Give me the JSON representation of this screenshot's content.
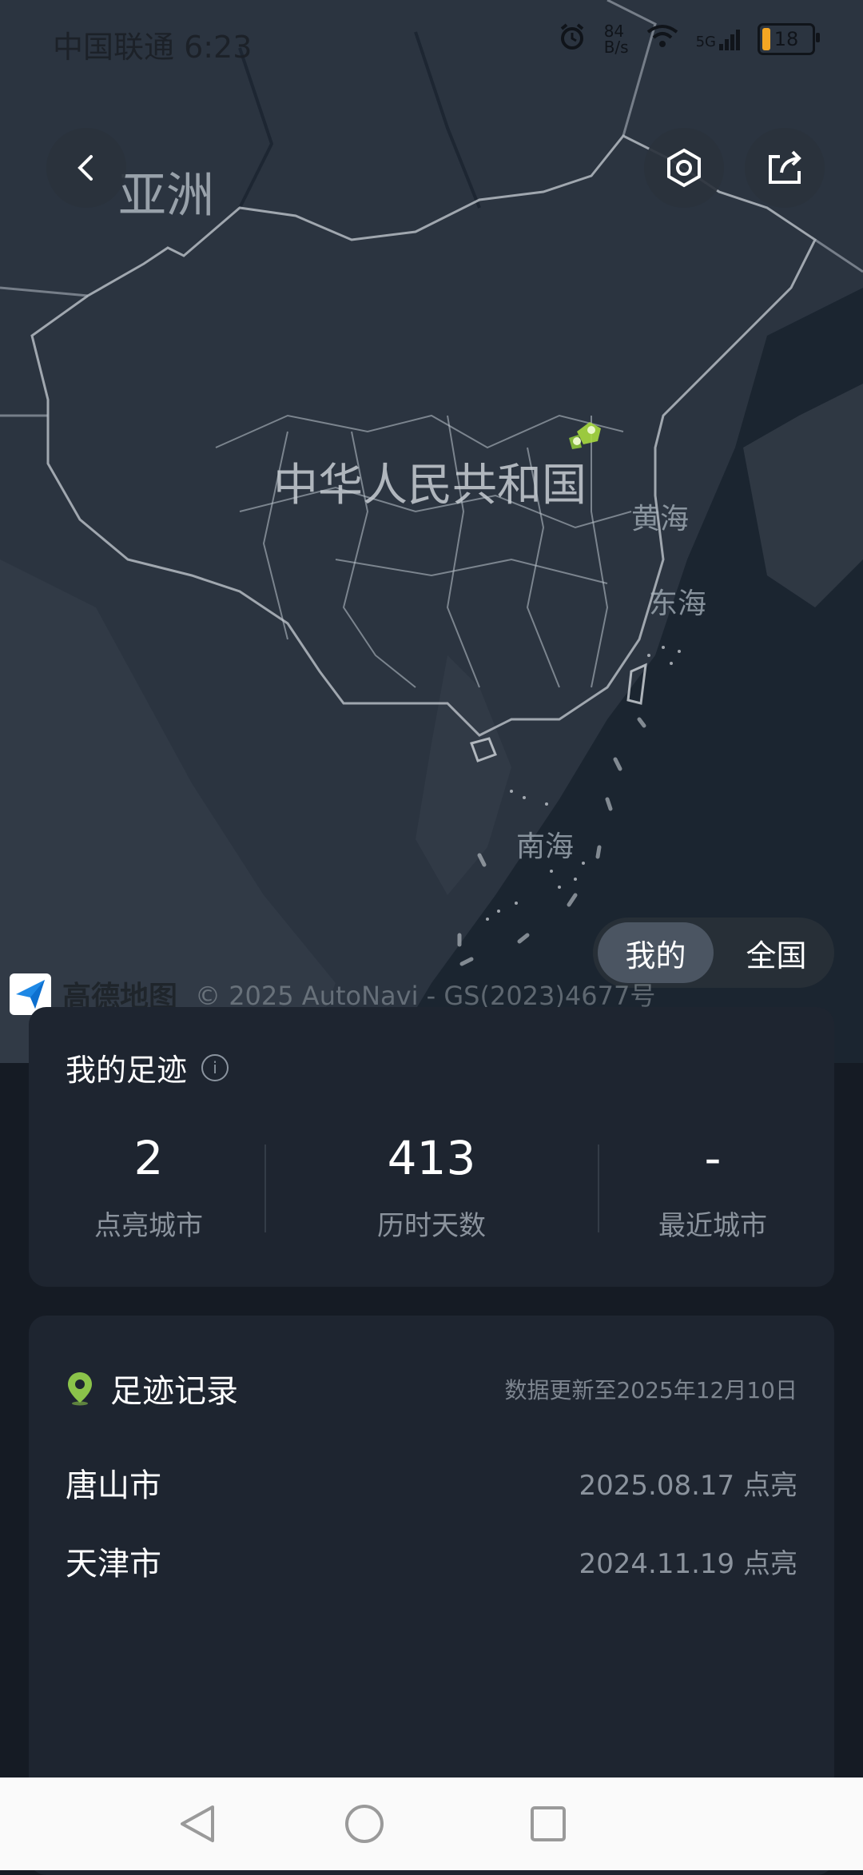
{
  "status_bar": {
    "carrier_time": "中国联通 6:23",
    "net_speed_value": "84",
    "net_speed_unit": "B/s",
    "network_type": "5G",
    "battery": "18"
  },
  "map": {
    "continent_label": "亚洲",
    "country_label": "中华人民共和国",
    "sea_labels": [
      "黄海",
      "东海",
      "南海"
    ],
    "highlight_color": "#a7d93f"
  },
  "toggle": {
    "options": [
      "我的",
      "全国"
    ],
    "selected": "我的"
  },
  "attribution": {
    "logo_text": "高德地图",
    "copyright": "© 2025 AutoNavi - GS(2023)4677号"
  },
  "footprint": {
    "title": "我的足迹",
    "stats": [
      {
        "value": "2",
        "label": "点亮城市"
      },
      {
        "value": "413",
        "label": "历时天数"
      },
      {
        "value": "-",
        "label": "最近城市"
      }
    ]
  },
  "records": {
    "title": "足迹记录",
    "update_note": "数据更新至2025年12月10日",
    "items": [
      {
        "city": "唐山市",
        "date": "2025.08.17 点亮"
      },
      {
        "city": "天津市",
        "date": "2024.11.19 点亮"
      }
    ]
  },
  "colors": {
    "background": "#151b24",
    "card": "#1e2530",
    "accent_green": "#8bc34a"
  }
}
